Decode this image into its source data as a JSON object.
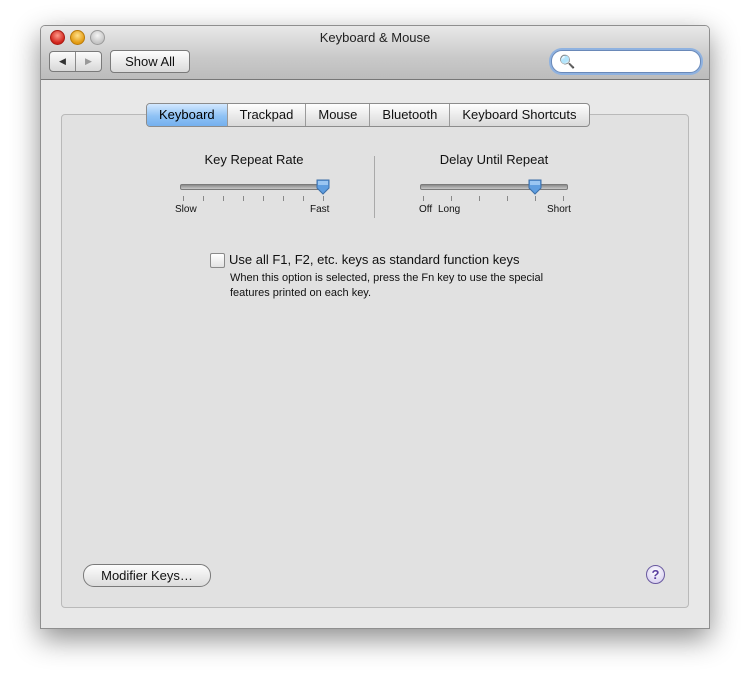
{
  "window": {
    "title": "Keyboard & Mouse"
  },
  "toolbar": {
    "back_label": "◀",
    "forward_label": "▶",
    "show_all_label": "Show All",
    "search_value": "",
    "search_placeholder": ""
  },
  "tabs": [
    {
      "label": "Keyboard",
      "active": true
    },
    {
      "label": "Trackpad",
      "active": false
    },
    {
      "label": "Mouse",
      "active": false
    },
    {
      "label": "Bluetooth",
      "active": false
    },
    {
      "label": "Keyboard Shortcuts",
      "active": false
    }
  ],
  "key_repeat": {
    "title": "Key Repeat Rate",
    "min_label": "Slow",
    "max_label": "Fast",
    "value_fraction": 1.0,
    "tick_count": 8
  },
  "delay_repeat": {
    "title": "Delay Until Repeat",
    "min_label": "Off",
    "mid_label": "Long",
    "max_label": "Short",
    "value_fraction": 0.8,
    "tick_count": 6
  },
  "function_keys": {
    "checked": false,
    "label": "Use all F1, F2, etc. keys as standard function keys",
    "description": "When this option is selected, press the Fn key to use the special features printed on each key."
  },
  "footer": {
    "modifier_keys_label": "Modifier Keys…",
    "help_label": "?"
  },
  "colors": {
    "active_tab": "#8fc2f5",
    "slider_knob": "#5f9ee0",
    "help": "#5a3ea0"
  }
}
